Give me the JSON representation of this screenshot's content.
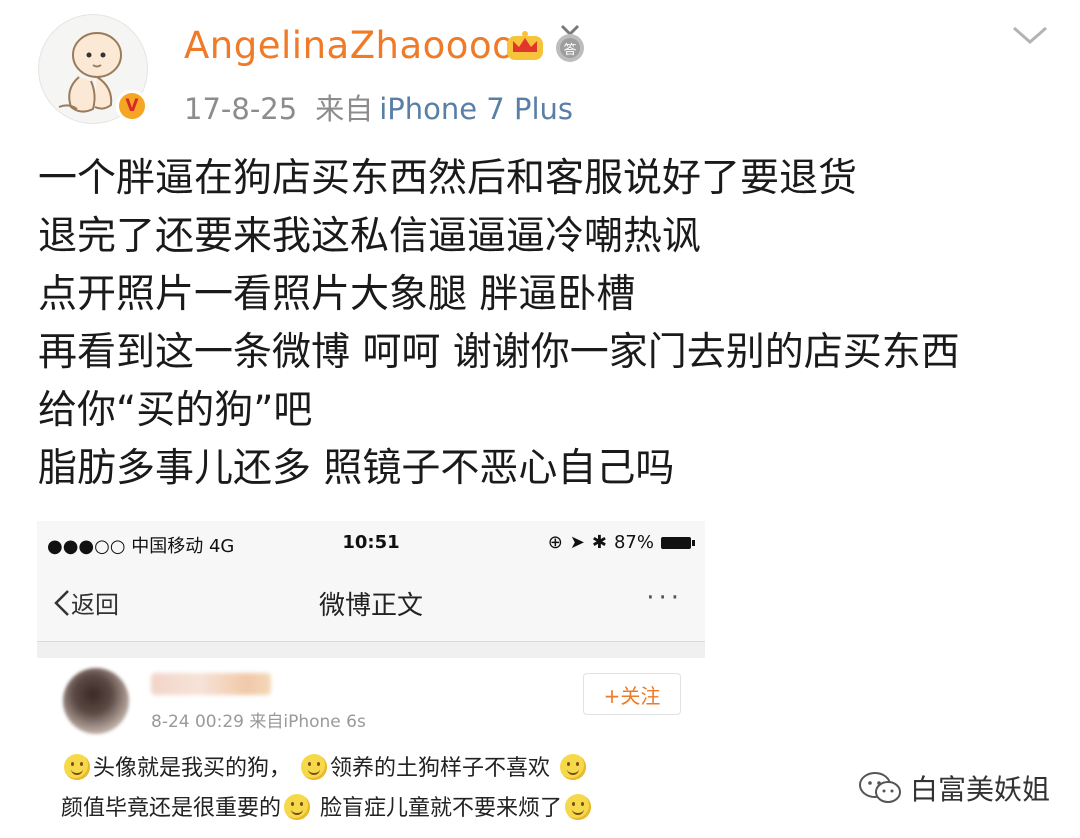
{
  "header": {
    "username": "AngelinaZhaoooo",
    "date": "17-8-25",
    "from_label": "来自",
    "source": "iPhone 7 Plus",
    "verified_badge": "V",
    "icons": [
      "crown-icon",
      "medal-icon",
      "chevron-down-icon"
    ]
  },
  "post": {
    "lines": [
      "一个胖逼在狗店买东西然后和客服说好了要退货",
      "退完了还要来我这私信逼逼逼冷嘲热讽",
      "点开照片一看照片大象腿 胖逼卧槽",
      "再看到这一条微博 呵呵 谢谢你一家门去别的店买东西",
      "给你“买的狗”吧",
      "脂肪多事儿还多 照镜子不恶心自己吗"
    ]
  },
  "screenshot": {
    "status": {
      "carrier": "●●●○○ 中国移动  4G",
      "time": "10:51",
      "battery": "87%"
    },
    "nav": {
      "back": "返回",
      "title": "微博正文",
      "more": "···"
    },
    "comment": {
      "meta": "8-24 00:29  来自iPhone 6s",
      "follow": "+关注",
      "line1_a": "头像就是我买的狗，",
      "line1_b": "领养的土狗样子不喜欢",
      "line2_a": "颜值毕竟还是很重要的",
      "line2_b": "脸盲症儿童就不要来烦了"
    }
  },
  "watermark": {
    "text": "白富美妖姐"
  },
  "colors": {
    "username": "#ef7a27",
    "source_link": "#5a7fa6",
    "meta_gray": "#8c8c8c"
  }
}
